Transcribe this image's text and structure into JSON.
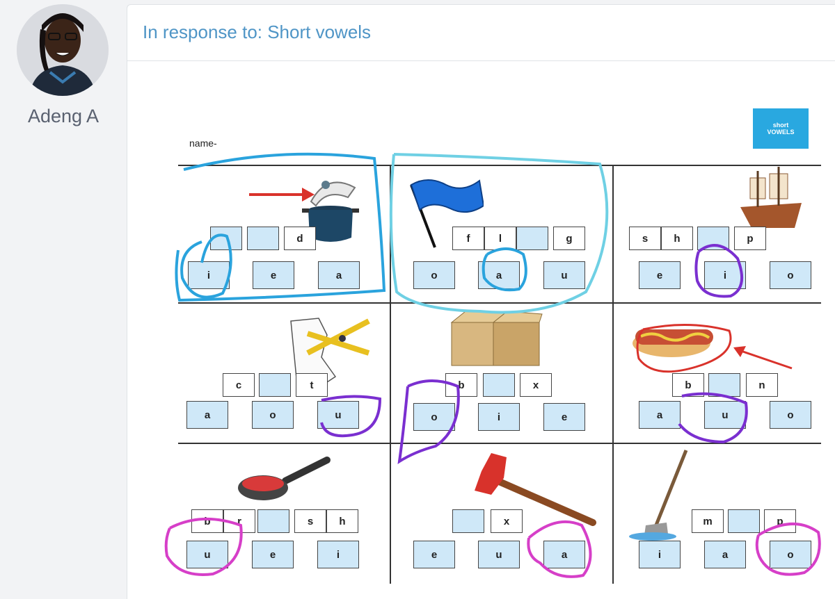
{
  "author": {
    "name": "Adeng A"
  },
  "post": {
    "title": "In response to: Short vowels"
  },
  "worksheet": {
    "name_label": "name-",
    "badge": {
      "line1": "short",
      "line2": "VOWELS"
    },
    "cells": [
      {
        "word_boxes": [
          "",
          "",
          "d"
        ],
        "options": [
          "i",
          "e",
          "a"
        ]
      },
      {
        "word_boxes": [
          "f",
          "l",
          "",
          "g"
        ],
        "options": [
          "o",
          "a",
          "u"
        ]
      },
      {
        "word_boxes": [
          "s",
          "h",
          "",
          "p"
        ],
        "options": [
          "e",
          "i",
          "o"
        ]
      },
      {
        "word_boxes": [
          "c",
          "",
          "t"
        ],
        "options": [
          "a",
          "o",
          "u"
        ]
      },
      {
        "word_boxes": [
          "b",
          "",
          "x"
        ],
        "options": [
          "o",
          "i",
          "e"
        ]
      },
      {
        "word_boxes": [
          "b",
          "",
          "n"
        ],
        "options": [
          "a",
          "u",
          "o"
        ]
      },
      {
        "word_boxes": [
          "b",
          "r",
          "",
          "s",
          "h"
        ],
        "options": [
          "u",
          "e",
          "i"
        ]
      },
      {
        "word_boxes": [
          "",
          "x"
        ],
        "options": [
          "e",
          "u",
          "a"
        ]
      },
      {
        "word_boxes": [
          "m",
          "",
          "p"
        ],
        "options": [
          "i",
          "a",
          "o"
        ]
      }
    ]
  },
  "colors": {
    "title": "#4f95c6",
    "box_fill": "#cfe8f8",
    "badge": "#29a8e0",
    "marker_blue": "#2aa3dd",
    "marker_cyan": "#6fd0e4",
    "marker_purple": "#7a2fd0",
    "marker_pink": "#d63fc8",
    "arrow_red": "#d9322b"
  }
}
